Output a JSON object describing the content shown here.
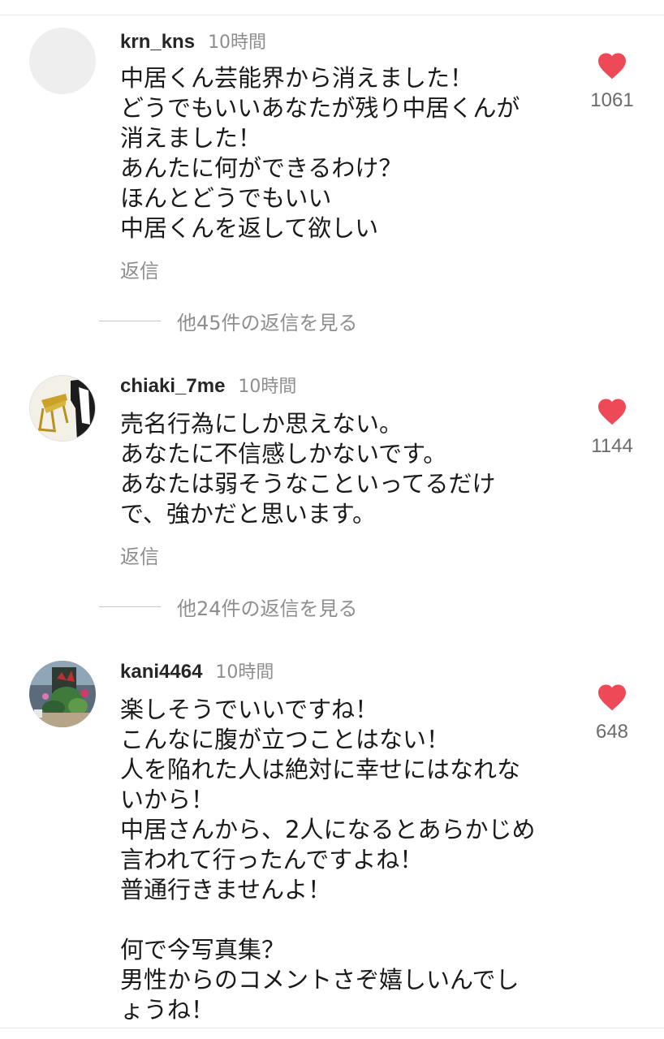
{
  "accent": {
    "heart": "#ed4956",
    "muted_text": "#8e8e8e"
  },
  "comments": [
    {
      "username": "krn_kns",
      "time": "10時間",
      "lines": [
        "中居くん芸能界から消えました！",
        "どうでもいいあなたが残り中居くんが",
        "消えました！",
        "あんたに何ができるわけ？",
        "ほんとどうでもいい",
        "中居くんを返して欲しい"
      ],
      "reply_label": "返信",
      "like_icon": "heart-icon",
      "like_count": "1061",
      "view_replies": "他45件の返信を見る",
      "avatar": "blank-avatar"
    },
    {
      "username": "chiaki_7me",
      "time": "10時間",
      "lines": [
        "売名行為にしか思えない。",
        "あなたに不信感しかないです。",
        "あなたは弱そうなこといってるだけ",
        "で、強かだと思います。"
      ],
      "reply_label": "返信",
      "like_icon": "heart-icon",
      "like_count": "1144",
      "view_replies": "他24件の返信を見る",
      "avatar": "chair-photo-avatar"
    },
    {
      "username": "kani4464",
      "time": "10時間",
      "lines": [
        "楽しそうでいいですね！",
        "こんなに腹が立つことはない！",
        "人を陥れた人は絶対に幸せにはなれな",
        "いから！",
        "中居さんから、2人になるとあらかじめ",
        "言われて行ったんですよね！",
        "普通行きませんよ！",
        "",
        "何で今写真集？",
        "男性からのコメントさぞ嬉しいんでし",
        "ょうね！"
      ],
      "like_icon": "heart-icon",
      "like_count": "648",
      "avatar": "plant-photo-avatar"
    }
  ]
}
